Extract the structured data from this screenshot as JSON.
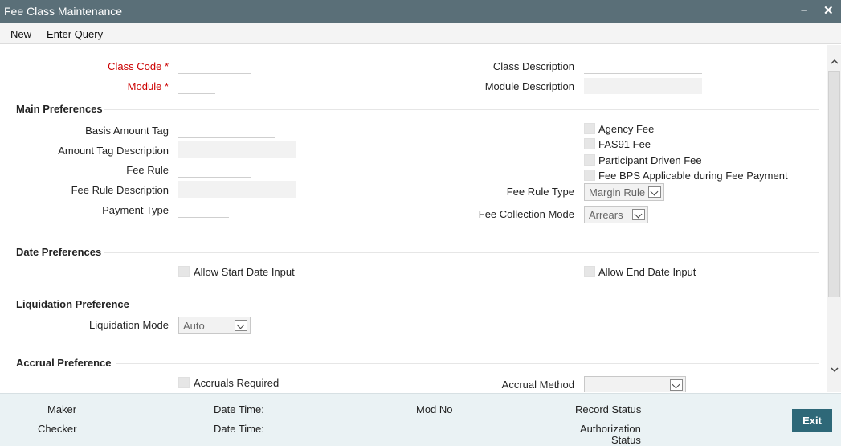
{
  "window": {
    "title": "Fee Class Maintenance",
    "minimize_glyph": "–",
    "close_glyph": "✕"
  },
  "menu": {
    "new_label": "New",
    "enter_query_label": "Enter Query"
  },
  "header": {
    "class_code_label": "Class Code",
    "module_label": "Module",
    "required_mark": "*",
    "class_description_label": "Class Description",
    "module_description_label": "Module Description"
  },
  "main_preferences": {
    "title": "Main Preferences",
    "basis_amount_tag_label": "Basis Amount Tag",
    "amount_tag_description_label": "Amount Tag Description",
    "fee_rule_label": "Fee Rule",
    "fee_rule_description_label": "Fee Rule Description",
    "payment_type_label": "Payment Type",
    "agency_fee_label": "Agency Fee",
    "fas91_fee_label": "FAS91 Fee",
    "participant_driven_fee_label": "Participant Driven Fee",
    "fee_bps_label": "Fee BPS Applicable during Fee Payment",
    "fee_rule_type_label": "Fee Rule Type",
    "fee_rule_type_value": "Margin Rule",
    "fee_collection_mode_label": "Fee Collection Mode",
    "fee_collection_mode_value": "Arrears"
  },
  "date_preferences": {
    "title": "Date Preferences",
    "allow_start_date_label": "Allow Start Date Input",
    "allow_end_date_label": "Allow End Date Input"
  },
  "liquidation_preference": {
    "title": "Liquidation Preference",
    "liquidation_mode_label": "Liquidation Mode",
    "liquidation_mode_value": "Auto"
  },
  "accrual_preference": {
    "title": "Accrual Preference",
    "accruals_required_label": "Accruals Required",
    "accrual_method_label": "Accrual Method",
    "accrual_method_value": ""
  },
  "footer": {
    "maker_label": "Maker",
    "checker_label": "Checker",
    "date_time_label_1": "Date Time:",
    "date_time_label_2": "Date Time:",
    "mod_no_label": "Mod No",
    "record_status_label": "Record Status",
    "authorization_status_label_line1": "Authorization",
    "authorization_status_label_line2": "Status",
    "exit_label": "Exit"
  },
  "colors": {
    "titlebar": "#5a6f78",
    "required": "#cc0000",
    "exit_button": "#2e6878",
    "footer": "#eaf2f4"
  }
}
